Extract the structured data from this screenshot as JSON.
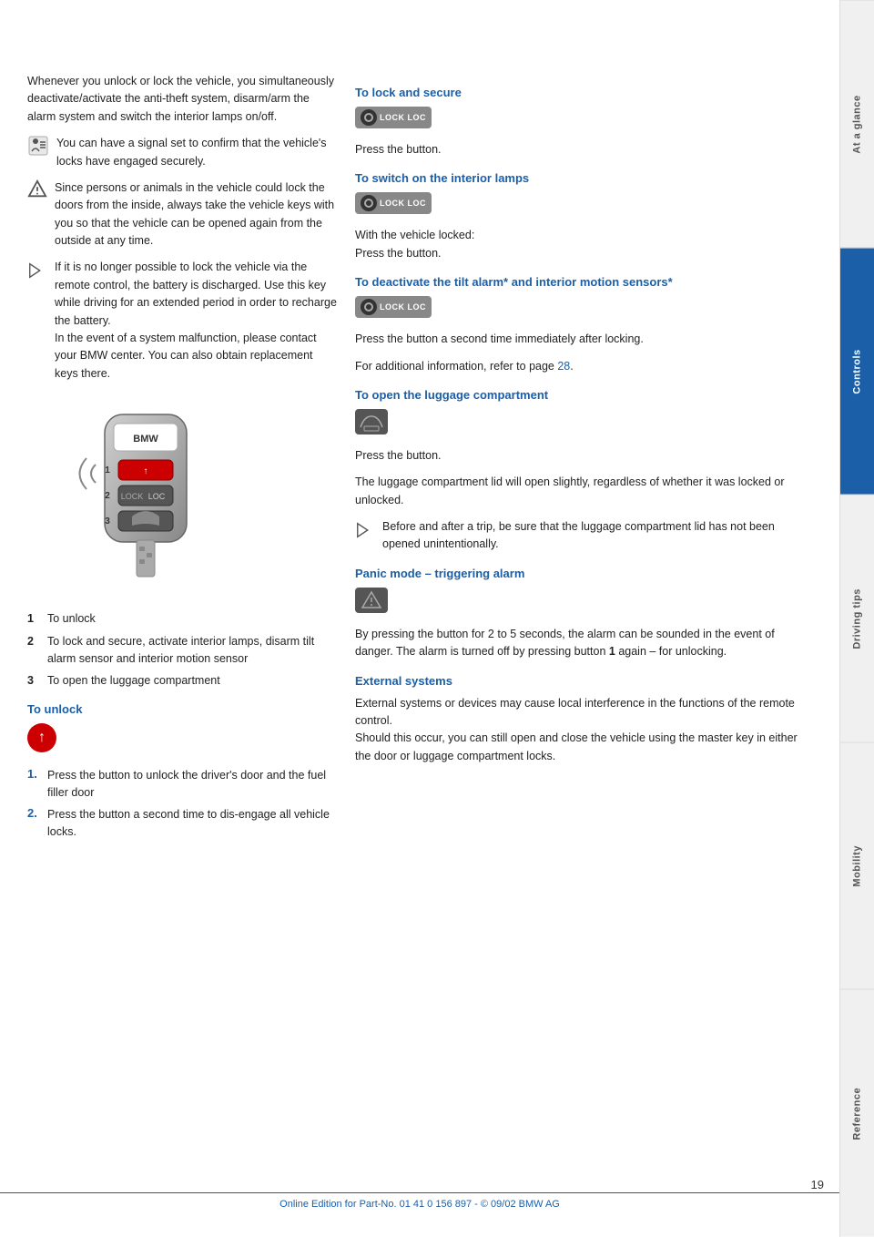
{
  "page": {
    "number": "19",
    "footer_text": "Online Edition for Part-No. 01 41 0 156 897 - © 09/02 BMW AG"
  },
  "sidebar": {
    "tabs": [
      {
        "label": "At a glance",
        "active": false
      },
      {
        "label": "Controls",
        "active": true
      },
      {
        "label": "Driving tips",
        "active": false
      },
      {
        "label": "Mobility",
        "active": false
      },
      {
        "label": "Reference",
        "active": false
      }
    ]
  },
  "left_column": {
    "intro_text": "Whenever you unlock or lock the vehicle, you simultaneously deactivate/activate the anti-theft system, disarm/arm the alarm system and switch the interior lamps on/off.",
    "note1": "You can have a signal set to confirm that the vehicle's locks have engaged securely.",
    "warning1": "Since persons or animals in the vehicle could lock the doors from the inside, always take the vehicle keys with you so that the vehicle can be opened again from the outside at any time.",
    "note2_text": "If it is no longer possible to lock the vehicle via the remote control, the battery is discharged. Use this key while driving for an extended period in order to recharge the battery.\nIn the event of a system malfunction, please contact your BMW center. You can also obtain replacement keys there.",
    "numbered_items": [
      {
        "num": "1",
        "text": "To unlock"
      },
      {
        "num": "2",
        "text": "To lock and secure, activate interior lamps, disarm tilt alarm sensor and interior motion sensor"
      },
      {
        "num": "3",
        "text": "To open the luggage compartment"
      }
    ],
    "to_unlock_heading": "To unlock",
    "to_unlock_steps": [
      {
        "num": "1.",
        "text": "Press the button to unlock the driver's door and the fuel filler door"
      },
      {
        "num": "2.",
        "text": "Press the button a second time to dis-engage all vehicle locks."
      }
    ]
  },
  "right_column": {
    "sections": [
      {
        "id": "lock_secure",
        "heading": "To lock and secure",
        "body": "Press the button."
      },
      {
        "id": "switch_interior_lamps",
        "heading": "To switch on the interior lamps",
        "body": "With the vehicle locked:\nPress the button."
      },
      {
        "id": "deactivate_tilt",
        "heading": "To deactivate the tilt alarm* and interior motion sensors*",
        "body_parts": [
          "Press the button a second time immediately after locking.",
          "For additional information, refer to page 28."
        ]
      },
      {
        "id": "open_luggage",
        "heading": "To open the luggage compartment",
        "body": "Press the button.",
        "extra": "The luggage compartment lid will open slightly, regardless of whether it was locked or unlocked.",
        "note": "Before and after a trip, be sure that the luggage compartment lid has not been opened unintentionally."
      },
      {
        "id": "panic_mode",
        "heading": "Panic mode – triggering alarm",
        "body": "By pressing the button for 2 to 5 seconds, the alarm can be sounded in the event of danger. The alarm is turned off by pressing button 1 again – for unlocking."
      },
      {
        "id": "external_systems",
        "heading": "External systems",
        "body": "External systems or devices may cause local interference in the functions of the remote control.\nShould this occur, you can still open and close the vehicle using the master key in either the door or luggage compartment locks."
      }
    ]
  }
}
